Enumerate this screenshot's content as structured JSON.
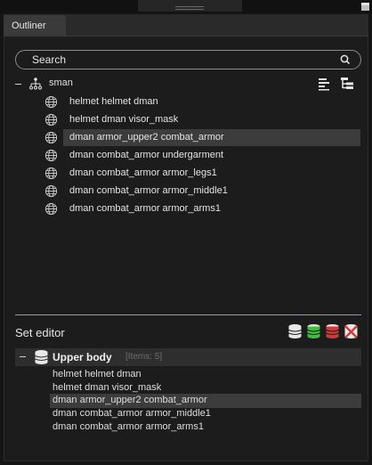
{
  "tabs": [
    {
      "label": "Outliner"
    }
  ],
  "search": {
    "placeholder": "Search"
  },
  "tree": {
    "root_label": "sman",
    "items": [
      {
        "label": "helmet helmet dman",
        "selected": false
      },
      {
        "label": "helmet dman visor_mask",
        "selected": false
      },
      {
        "label": "dman armor_upper2 combat_armor",
        "selected": true
      },
      {
        "label": "dman combat_armor undergarment",
        "selected": false
      },
      {
        "label": "dman combat_armor armor_legs1",
        "selected": false
      },
      {
        "label": "dman combat_armor armor_middle1",
        "selected": false
      },
      {
        "label": "dman combat_armor armor_arms1",
        "selected": false
      }
    ]
  },
  "set_editor": {
    "title": "Set editor",
    "set_name": "Upper body",
    "item_count": "[Items: 5]",
    "items": [
      {
        "label": "helmet helmet dman",
        "selected": false
      },
      {
        "label": "helmet dman visor_mask",
        "selected": false
      },
      {
        "label": "dman armor_upper2 combat_armor",
        "selected": true
      },
      {
        "label": "dman combat_armor armor_middle1",
        "selected": false
      },
      {
        "label": "dman combat_armor armor_arms1",
        "selected": false
      }
    ]
  },
  "colors": {
    "db_white": "#e8e8e8",
    "db_green": "#3fbf3f",
    "db_red": "#d23a3a",
    "highlight": "#3c3c3c"
  },
  "icons": {
    "search": "search-icon",
    "hierarchy": "hierarchy-icon",
    "align": "align-left-icon",
    "tree_view": "tree-view-icon",
    "mesh": "mesh-globe-icon",
    "set": "database-icon"
  }
}
